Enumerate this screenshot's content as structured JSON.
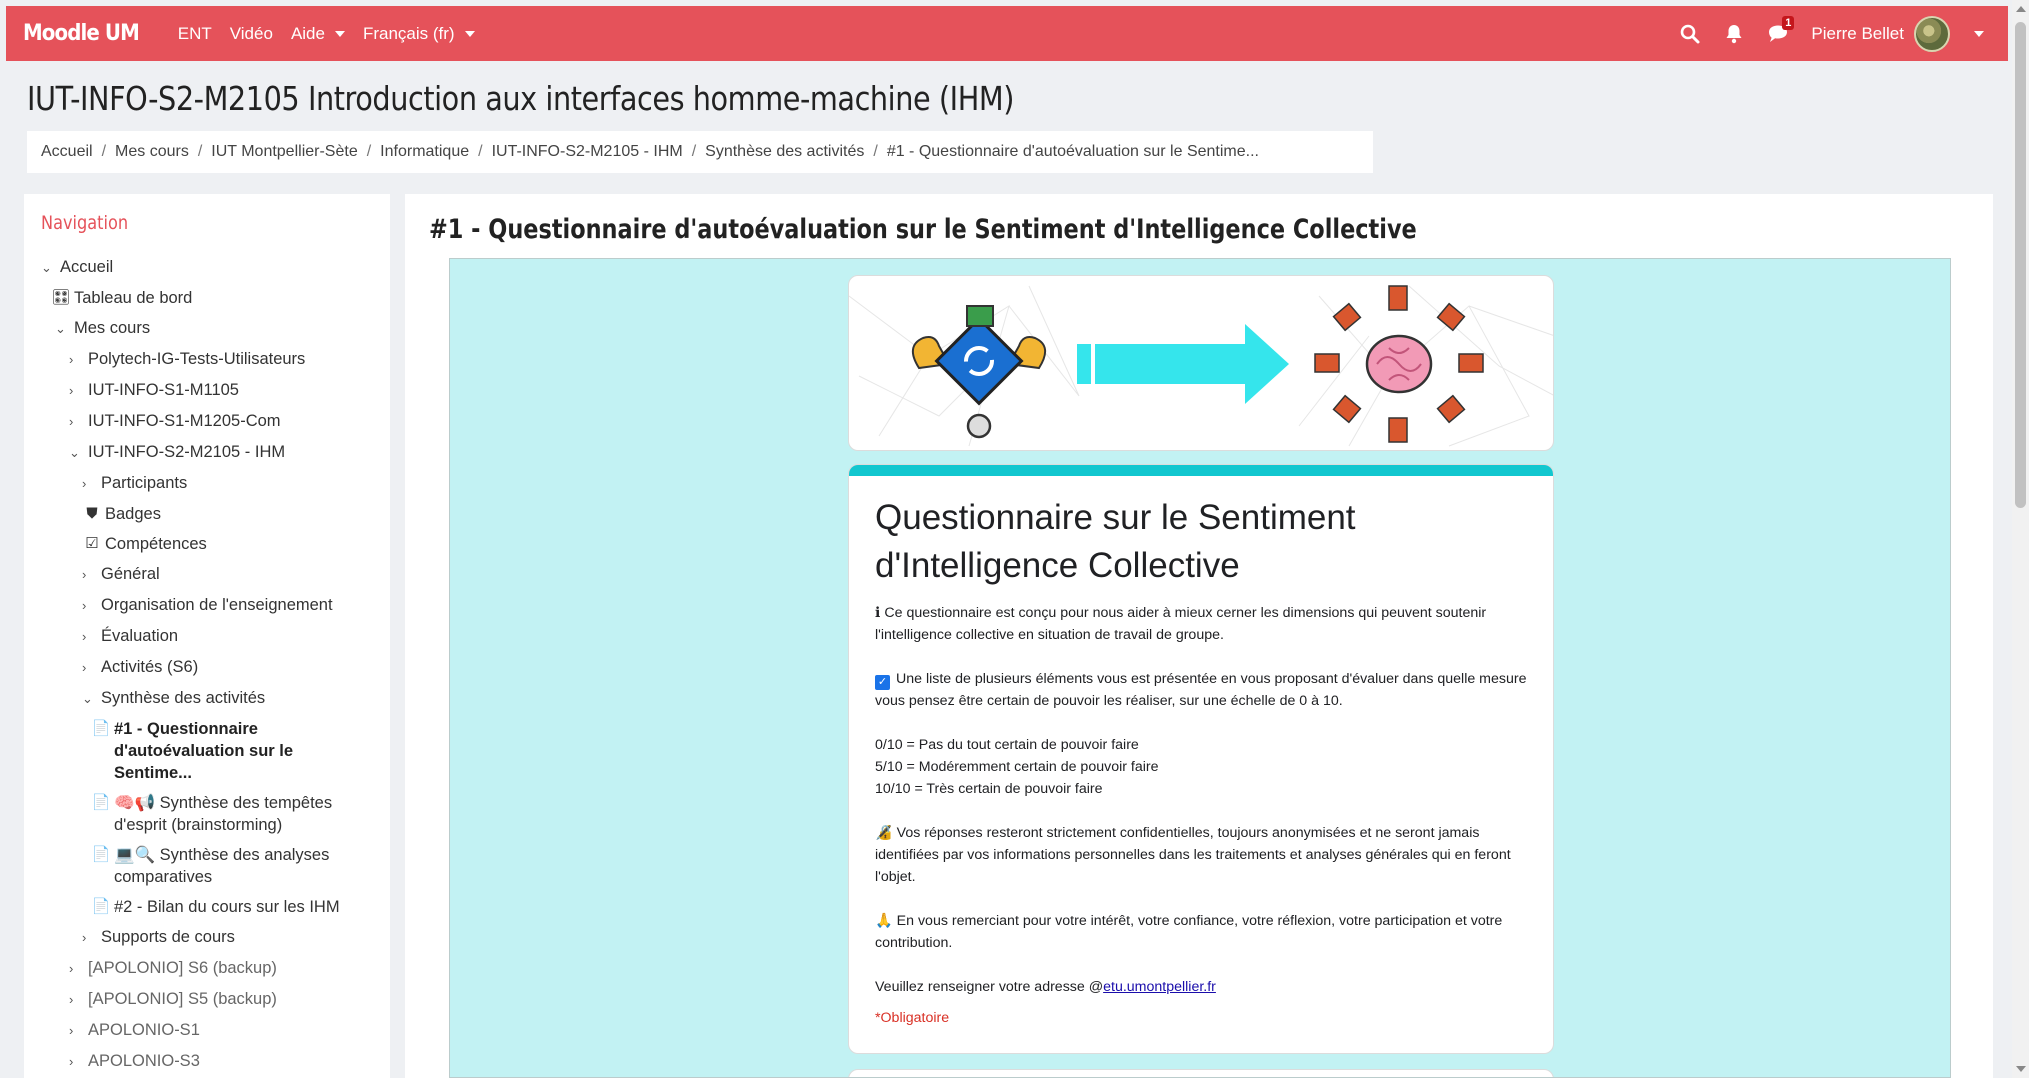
{
  "topbar": {
    "brand": "Moodle UM",
    "links": [
      "ENT",
      "Vidéo"
    ],
    "help_label": "Aide",
    "language_label": "Français (fr)",
    "message_badge": "1",
    "user_name": "Pierre Bellet",
    "icons": [
      "search-icon",
      "bell-icon",
      "chat-icon",
      "avatar",
      "chevron-down-icon"
    ]
  },
  "course": {
    "title": "IUT-INFO-S2-M2105 Introduction aux interfaces homme-machine (IHM)"
  },
  "breadcrumb": [
    "Accueil",
    "Mes cours",
    "IUT Montpellier-Sète",
    "Informatique",
    "IUT-INFO-S2-M2105 - IHM",
    "Synthèse des activités",
    "#1 - Questionnaire d'autoévaluation sur le Sentime..."
  ],
  "nav": {
    "title": "Navigation",
    "items": [
      {
        "label": "Accueil",
        "chev": "⌄",
        "icon": ""
      },
      {
        "label": "Tableau de bord",
        "chev": "",
        "icon": "🎛"
      },
      {
        "label": "Mes cours",
        "chev": "⌄",
        "icon": ""
      },
      {
        "label": "Polytech-IG-Tests-Utilisateurs",
        "chev": "›",
        "icon": ""
      },
      {
        "label": "IUT-INFO-S1-M1105",
        "chev": "›",
        "icon": ""
      },
      {
        "label": "IUT-INFO-S1-M1205-Com",
        "chev": "›",
        "icon": ""
      },
      {
        "label": "IUT-INFO-S2-M2105 - IHM",
        "chev": "⌄",
        "icon": ""
      },
      {
        "label": "Participants",
        "chev": "›",
        "icon": ""
      },
      {
        "label": "Badges",
        "chev": "",
        "icon": "⛊"
      },
      {
        "label": "Compétences",
        "chev": "",
        "icon": "☑"
      },
      {
        "label": "Général",
        "chev": "›",
        "icon": ""
      },
      {
        "label": "Organisation de l'enseignement",
        "chev": "›",
        "icon": ""
      },
      {
        "label": "Évaluation",
        "chev": "›",
        "icon": ""
      },
      {
        "label": "Activités (S6)",
        "chev": "›",
        "icon": ""
      },
      {
        "label": "Synthèse des activités",
        "chev": "⌄",
        "icon": ""
      },
      {
        "label": "#1 - Questionnaire d'autoévaluation sur le Sentime...",
        "chev": "",
        "icon": "📄"
      },
      {
        "label": "🧠📢 Synthèse des tempêtes d'esprit (brainstorming)",
        "chev": "",
        "icon": "📄"
      },
      {
        "label": "💻🔍 Synthèse des analyses comparatives",
        "chev": "",
        "icon": "📄"
      },
      {
        "label": "#2 - Bilan du cours sur les IHM",
        "chev": "",
        "icon": "📄"
      },
      {
        "label": "Supports de cours",
        "chev": "›",
        "icon": ""
      },
      {
        "label": "[APOLONIO] S6 (backup)",
        "chev": "›",
        "icon": ""
      },
      {
        "label": "[APOLONIO] S5 (backup)",
        "chev": "›",
        "icon": ""
      },
      {
        "label": "APOLONIO-S1",
        "chev": "›",
        "icon": ""
      },
      {
        "label": "APOLONIO-S3",
        "chev": "›",
        "icon": ""
      }
    ]
  },
  "activity": {
    "title": "#1 - Questionnaire d'autoévaluation sur le Sentiment d'Intelligence Collective"
  },
  "form": {
    "title": "Questionnaire sur le Sentiment d'Intelligence Collective",
    "intro_icon": "ℹ",
    "intro": "Ce questionnaire est conçu pour nous aider à mieux cerner les dimensions qui peuvent soutenir l'intelligence collective en situation de travail de groupe.",
    "list_text": "Une liste de plusieurs éléments vous est présentée en vous proposant d'évaluer dans quelle mesure vous pensez être certain de pouvoir les réaliser, sur une échelle de 0 à 10.",
    "scale": [
      "0/10 = Pas du tout certain de pouvoir faire",
      "5/10 = Modéremment certain de pouvoir faire",
      "10/10 = Très certain de pouvoir faire"
    ],
    "privacy_icon": "🔏",
    "privacy": "Vos réponses resteront strictement confidentielles, toujours anonymisées et ne seront jamais identifiées par vos informations personnelles dans les traitements et analyses générales qui en feront l'objet.",
    "thanks_icon": "🙏",
    "thanks": "En vous remerciant pour votre intérêt, votre confiance, votre réflexion, votre participation et votre contribution.",
    "email_prefix": "Veuillez renseigner votre adresse @",
    "email_domain": "etu.umontpellier.fr",
    "required": "*Obligatoire"
  },
  "colors": {
    "topbar": "#e5525a",
    "accent_teal": "#12c7cf",
    "frame_bg": "#c2f2f3"
  }
}
